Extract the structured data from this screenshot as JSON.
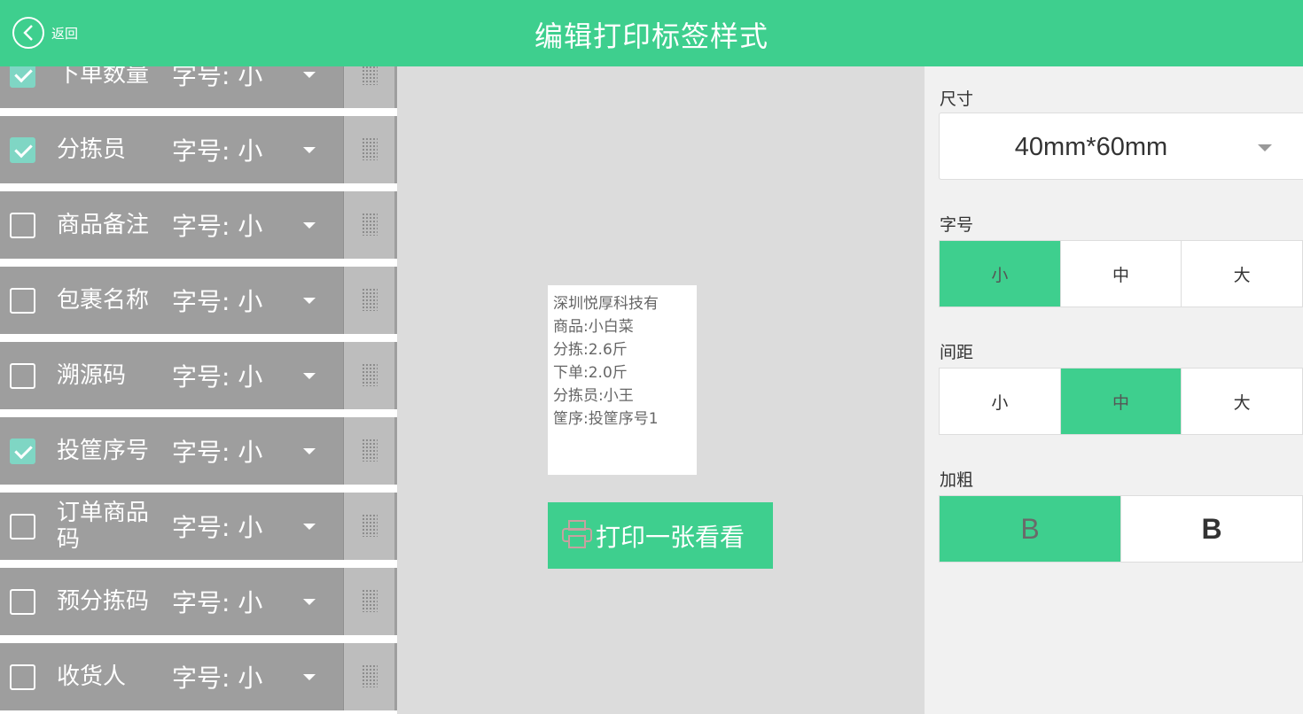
{
  "header": {
    "back_label": "返回",
    "title": "编辑打印标签样式"
  },
  "fields": [
    {
      "name": "下单数量",
      "checked": true,
      "size": "字号: 小"
    },
    {
      "name": "分拣员",
      "checked": true,
      "size": "字号: 小"
    },
    {
      "name": "商品备注",
      "checked": false,
      "size": "字号: 小"
    },
    {
      "name": "包裹名称",
      "checked": false,
      "size": "字号: 小"
    },
    {
      "name": "溯源码",
      "checked": false,
      "size": "字号: 小"
    },
    {
      "name": "投筐序号",
      "checked": true,
      "size": "字号: 小"
    },
    {
      "name": "订单商品码",
      "checked": false,
      "size": "字号: 小"
    },
    {
      "name": "预分拣码",
      "checked": false,
      "size": "字号: 小"
    },
    {
      "name": "收货人",
      "checked": false,
      "size": "字号: 小"
    }
  ],
  "preview": {
    "lines": [
      "深圳悦厚科技有",
      "商品:小白菜",
      "分拣:2.6斤",
      "下单:2.0斤",
      "分拣员:小王",
      "筐序:投筐序号1"
    ],
    "print_label": "打印一张看看"
  },
  "settings": {
    "size_label": "尺寸",
    "size_value": "40mm*60mm",
    "font_label": "字号",
    "font_options": [
      "小",
      "中",
      "大"
    ],
    "font_selected": 0,
    "spacing_label": "间距",
    "spacing_options": [
      "小",
      "中",
      "大"
    ],
    "spacing_selected": 1,
    "bold_label": "加粗",
    "bold_options": [
      "B",
      "B"
    ],
    "bold_selected": 0
  },
  "colors": {
    "accent": "#3ecf8e",
    "row_bg": "#9e9e9e",
    "checked": "#7fd6c4"
  }
}
